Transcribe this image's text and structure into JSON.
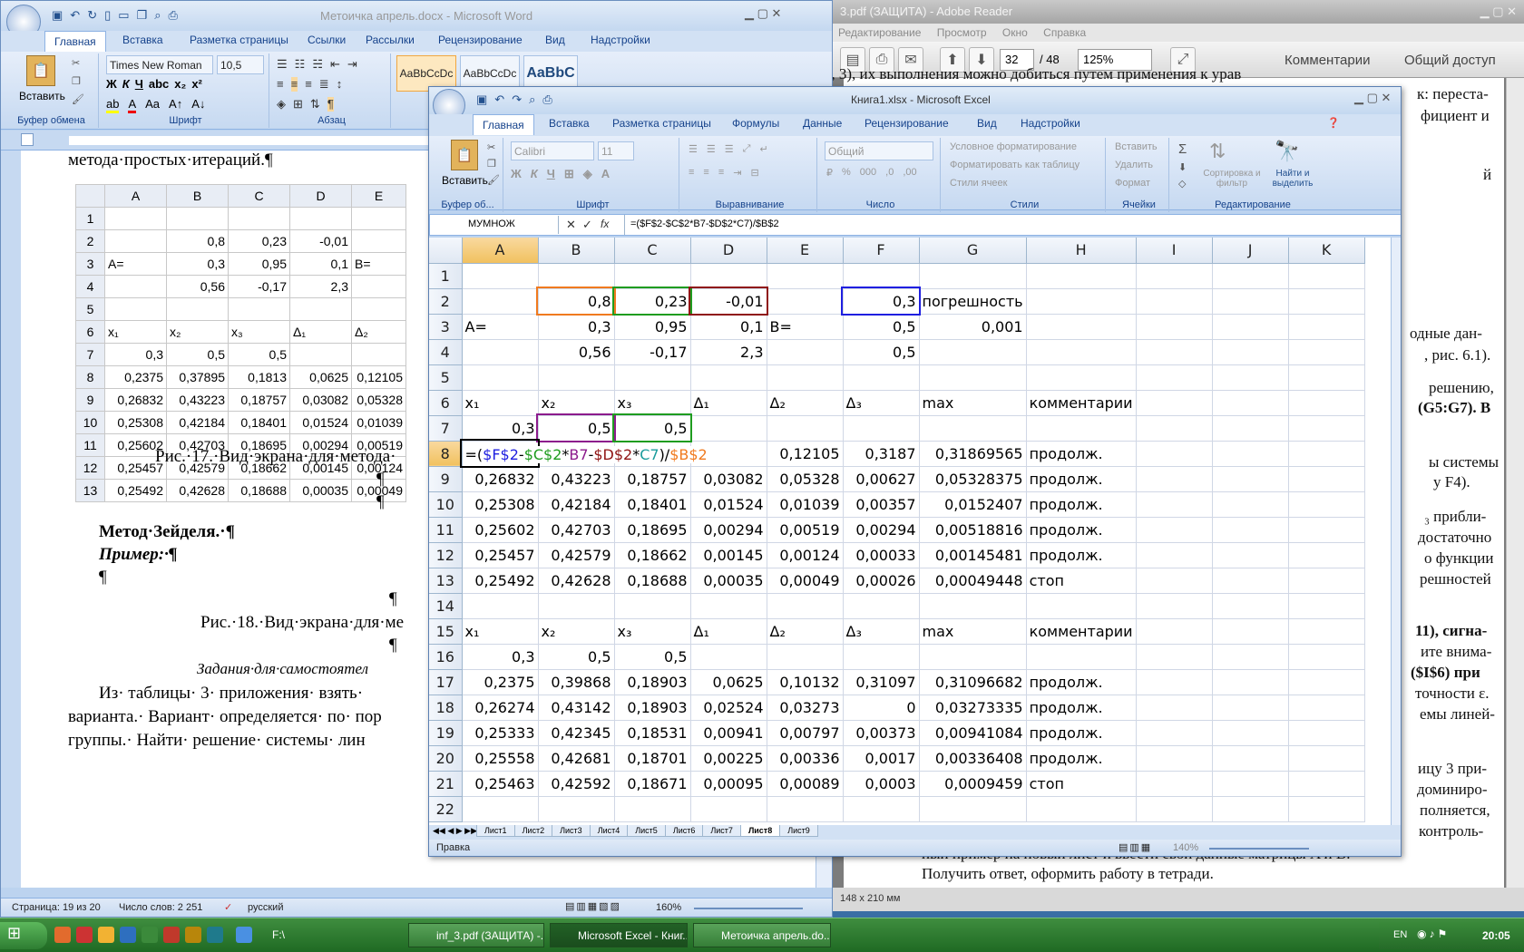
{
  "adobe": {
    "title": "3.pdf (ЗАЩИТА) - Adobe Reader",
    "menu": [
      "Редактирование",
      "Просмотр",
      "Окно",
      "Справка"
    ],
    "page_current": "32",
    "page_total": "/ 48",
    "zoom": "125%",
    "comments_label": "Комментарии",
    "share_label": "Общий доступ",
    "page_size": "148 x 210 мм",
    "lines": [
      "ᵢ = 1, 2, 3), их выполнения можно добиться путем применения к урав",
      "к: переста-",
      "фициент и",
      "й",
      "одные дан-",
      ", рис. 6.1).",
      "решению,",
      "(G5:G7). В",
      "ы системы",
      "у F4).",
      "₃ прибли-",
      "достаточно",
      "о функции",
      "решностей",
      "11), сигна-",
      "ите внима-",
      "($I$6) при",
      "точности ε.",
      "емы линей-",
      "ицу 3 при-",
      "доминиро-",
      "полняется,",
      "контроль-",
      "ный пример на новый лист и ввести свои данные       матрицы A и B.",
      "Получить ответ, оформить работу в тетради."
    ]
  },
  "word": {
    "title": "Метоичка апрель.docx - Microsoft Word",
    "tabs": [
      "Главная",
      "Вставка",
      "Разметка страницы",
      "Ссылки",
      "Рассылки",
      "Рецензирование",
      "Вид",
      "Надстройки"
    ],
    "font_name": "Times New Roman",
    "font_size": "10,5",
    "group_labels": [
      "Буфер обмена",
      "Шрифт",
      "Абзац"
    ],
    "paste_label": "Вставить",
    "styles": [
      "AaBbCcDc",
      "AaBbCcDc",
      "AaBbC"
    ],
    "body": {
      "heading": "метода·простых·итераций.¶",
      "caption17": "Рис.·17.·Вид·экрана·для·метода·",
      "pilcrow": "¶",
      "seidel": "Метод·Зейделя.·¶",
      "example": "Пример:·¶",
      "caption18": "Рис.·18.·Вид·экрана·для·ме",
      "tasks": "Задания·для·самостоятел",
      "p1": "Из· таблицы· 3· приложения· взять·",
      "p2": "варианта.· Вариант· определяется· по· пор",
      "p3": "группы.· Найти· решение· системы· лин"
    },
    "table": {
      "cols": [
        "A",
        "B",
        "C",
        "D",
        "E"
      ],
      "rows": [
        [
          "1",
          "",
          "",
          "",
          "",
          ""
        ],
        [
          "2",
          "",
          "0,8",
          "0,23",
          "-0,01",
          ""
        ],
        [
          "3",
          "A=",
          "0,3",
          "0,95",
          "0,1",
          "B="
        ],
        [
          "4",
          "",
          "0,56",
          "-0,17",
          "2,3",
          ""
        ],
        [
          "5",
          "",
          "",
          "",
          "",
          ""
        ],
        [
          "6",
          "x₁",
          "x₂",
          "x₃",
          "Δ₁",
          "Δ₂"
        ],
        [
          "7",
          "0,3",
          "0,5",
          "0,5",
          "",
          ""
        ],
        [
          "8",
          "0,2375",
          "0,37895",
          "0,1813",
          "0,0625",
          "0,12105"
        ],
        [
          "9",
          "0,26832",
          "0,43223",
          "0,18757",
          "0,03082",
          "0,05328"
        ],
        [
          "10",
          "0,25308",
          "0,42184",
          "0,18401",
          "0,01524",
          "0,01039"
        ],
        [
          "11",
          "0,25602",
          "0,42703",
          "0,18695",
          "0,00294",
          "0,00519"
        ],
        [
          "12",
          "0,25457",
          "0,42579",
          "0,18662",
          "0,00145",
          "0,00124"
        ],
        [
          "13",
          "0,25492",
          "0,42628",
          "0,18688",
          "0,00035",
          "0,00049"
        ]
      ]
    },
    "status": {
      "page": "Страница: 19 из 20",
      "words": "Число слов: 2 251",
      "lang": "русский",
      "zoom": "160%"
    }
  },
  "excel": {
    "title": "Книга1.xlsx - Microsoft Excel",
    "tabs": [
      "Главная",
      "Вставка",
      "Разметка страницы",
      "Формулы",
      "Данные",
      "Рецензирование",
      "Вид",
      "Надстройки"
    ],
    "font_name": "Calibri",
    "font_size": "11",
    "number_format": "Общий",
    "group_labels": [
      "Буфер об...",
      "Шрифт",
      "Выравнивание",
      "Число",
      "Стили",
      "Ячейки",
      "Редактирование"
    ],
    "paste_label": "Вставить",
    "styles_items": [
      "Условное форматирование",
      "Форматировать как таблицу",
      "Стили ячеек"
    ],
    "cells_items": [
      "Вставить",
      "Удалить",
      "Формат"
    ],
    "edit_items": [
      "Сортировка и фильтр",
      "Найти и выделить"
    ],
    "name_box": "МУМНОЖ",
    "formula": "=($F$2-$C$2*B7-$D$2*C7)/$B$2",
    "columns": [
      "A",
      "B",
      "C",
      "D",
      "E",
      "F",
      "G",
      "H",
      "I",
      "J",
      "K"
    ],
    "rows": [
      [
        "1",
        "",
        "",
        "",
        "",
        "",
        "",
        "",
        "",
        "",
        "",
        ""
      ],
      [
        "2",
        "",
        "0,8",
        "0,23",
        "-0,01",
        "",
        "0,3",
        "погрешность",
        "",
        "",
        "",
        ""
      ],
      [
        "3",
        "A=",
        "0,3",
        "0,95",
        "0,1",
        "B=",
        "0,5",
        "0,001",
        "",
        "",
        "",
        ""
      ],
      [
        "4",
        "",
        "0,56",
        "-0,17",
        "2,3",
        "",
        "0,5",
        "",
        "",
        "",
        "",
        ""
      ],
      [
        "5",
        "",
        "",
        "",
        "",
        "",
        "",
        "",
        "",
        "",
        "",
        ""
      ],
      [
        "6",
        "x₁",
        "x₂",
        "x₃",
        "Δ₁",
        "Δ₂",
        "Δ₃",
        "max",
        "комментарии",
        "",
        "",
        ""
      ],
      [
        "7",
        "0,3",
        "0,5",
        "0,5",
        "",
        "",
        "",
        "",
        "",
        "",
        "",
        ""
      ],
      [
        "8",
        "",
        "",
        "",
        "",
        "0,12105",
        "0,3187",
        "0,31869565",
        "продолж.",
        "",
        "",
        ""
      ],
      [
        "9",
        "0,26832",
        "0,43223",
        "0,18757",
        "0,03082",
        "0,05328",
        "0,00627",
        "0,05328375",
        "продолж.",
        "",
        "",
        ""
      ],
      [
        "10",
        "0,25308",
        "0,42184",
        "0,18401",
        "0,01524",
        "0,01039",
        "0,00357",
        "0,0152407",
        "продолж.",
        "",
        "",
        ""
      ],
      [
        "11",
        "0,25602",
        "0,42703",
        "0,18695",
        "0,00294",
        "0,00519",
        "0,00294",
        "0,00518816",
        "продолж.",
        "",
        "",
        ""
      ],
      [
        "12",
        "0,25457",
        "0,42579",
        "0,18662",
        "0,00145",
        "0,00124",
        "0,00033",
        "0,00145481",
        "продолж.",
        "",
        "",
        ""
      ],
      [
        "13",
        "0,25492",
        "0,42628",
        "0,18688",
        "0,00035",
        "0,00049",
        "0,00026",
        "0,00049448",
        "стоп",
        "",
        "",
        ""
      ],
      [
        "14",
        "",
        "",
        "",
        "",
        "",
        "",
        "",
        "",
        "",
        "",
        ""
      ],
      [
        "15",
        "x₁",
        "x₂",
        "x₃",
        "Δ₁",
        "Δ₂",
        "Δ₃",
        "max",
        "комментарии",
        "",
        "",
        ""
      ],
      [
        "16",
        "0,3",
        "0,5",
        "0,5",
        "",
        "",
        "",
        "",
        "",
        "",
        "",
        ""
      ],
      [
        "17",
        "0,2375",
        "0,39868",
        "0,18903",
        "0,0625",
        "0,10132",
        "0,31097",
        "0,31096682",
        "продолж.",
        "",
        "",
        ""
      ],
      [
        "18",
        "0,26274",
        "0,43142",
        "0,18903",
        "0,02524",
        "0,03273",
        "0",
        "0,03273335",
        "продолж.",
        "",
        "",
        ""
      ],
      [
        "19",
        "0,25333",
        "0,42345",
        "0,18531",
        "0,00941",
        "0,00797",
        "0,00373",
        "0,00941084",
        "продолж.",
        "",
        "",
        ""
      ],
      [
        "20",
        "0,25558",
        "0,42681",
        "0,18701",
        "0,00225",
        "0,00336",
        "0,0017",
        "0,00336408",
        "продолж.",
        "",
        "",
        ""
      ],
      [
        "21",
        "0,25463",
        "0,42592",
        "0,18671",
        "0,00095",
        "0,00089",
        "0,0003",
        "0,0009459",
        "стоп",
        "",
        "",
        ""
      ],
      [
        "22",
        "",
        "",
        "",
        "",
        "",
        "",
        "",
        "",
        "",
        "",
        ""
      ]
    ],
    "edit_cell_parts": [
      {
        "t": "=(",
        "c": ""
      },
      {
        "t": "$F$2",
        "c": "f1"
      },
      {
        "t": "-",
        "c": ""
      },
      {
        "t": "$C$2",
        "c": "f2"
      },
      {
        "t": "*",
        "c": ""
      },
      {
        "t": "B7",
        "c": "f3"
      },
      {
        "t": "-",
        "c": ""
      },
      {
        "t": "$D$2",
        "c": "f4"
      },
      {
        "t": "*",
        "c": ""
      },
      {
        "t": "C7",
        "c": "f5"
      },
      {
        "t": ")/",
        "c": ""
      },
      {
        "t": "$B$2",
        "c": "f6"
      }
    ],
    "sheets": [
      "Лист1",
      "Лист2",
      "Лист3",
      "Лист4",
      "Лист5",
      "Лист6",
      "Лист7",
      "Лист8",
      "Лист9"
    ],
    "active_sheet": "Лист8",
    "status": "Правка",
    "zoom": "140%"
  },
  "taskbar": {
    "folder": "F:\\",
    "items": [
      "inf_3.pdf (ЗАЩИТА) -...",
      "Microsoft Excel - Книг...",
      "Метоичка апрель.do..."
    ],
    "lang": "EN",
    "time": "20:05"
  }
}
